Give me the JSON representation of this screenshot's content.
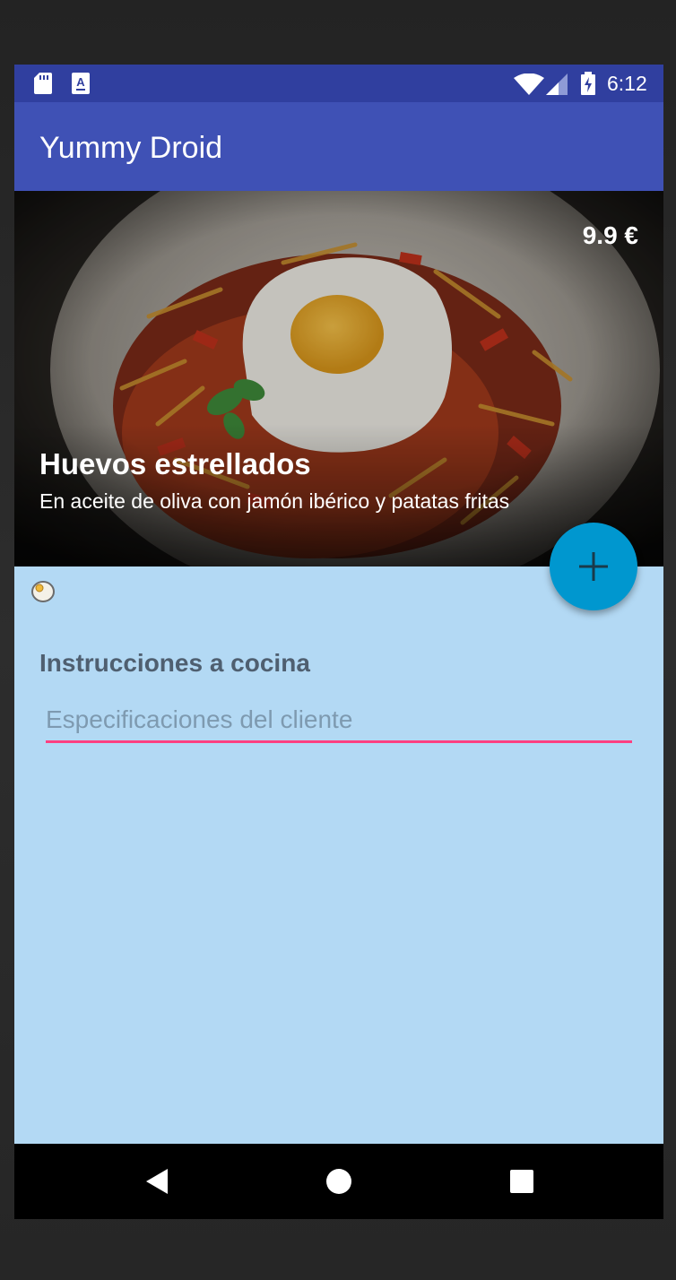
{
  "status_bar": {
    "time": "6:12",
    "icons": [
      "sd-card-icon",
      "keyboard-a-icon",
      "wifi-icon",
      "signal-icon",
      "battery-charging-icon"
    ]
  },
  "app_bar": {
    "title": "Yummy Droid",
    "color": "#3f51b5"
  },
  "dish": {
    "price": "9.9 €",
    "name": "Huevos estrellados",
    "description": "En aceite de oliva con jamón ibérico y patatas fritas",
    "image_icon": "fried-egg-photo"
  },
  "fab": {
    "icon": "plus-icon",
    "color": "#0097cf"
  },
  "category_icon": "egg-icon",
  "instructions": {
    "label": "Instrucciones a cocina",
    "placeholder": "Especificaciones del cliente",
    "value": ""
  },
  "nav_bar": {
    "icons": [
      "back-icon",
      "home-icon",
      "recents-icon"
    ]
  },
  "colors": {
    "status_bar": "#303f9f",
    "accent": "#ff4081",
    "background": "#b3d9f4"
  }
}
